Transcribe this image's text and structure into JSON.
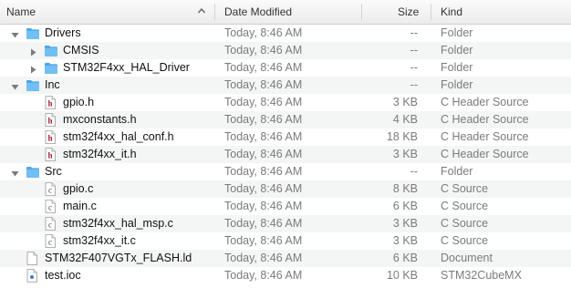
{
  "columns": {
    "name": "Name",
    "date": "Date Modified",
    "size": "Size",
    "kind": "Kind"
  },
  "rows": [
    {
      "name": "Drivers",
      "date": "Today, 8:46 AM",
      "size": "--",
      "kind": "Folder",
      "icon": "folder-icon",
      "level": 0,
      "disclosure": "expanded",
      "alt": false
    },
    {
      "name": "CMSIS",
      "date": "Today, 8:46 AM",
      "size": "--",
      "kind": "Folder",
      "icon": "folder-icon",
      "level": 1,
      "disclosure": "collapsed",
      "alt": true
    },
    {
      "name": "STM32F4xx_HAL_Driver",
      "date": "Today, 8:46 AM",
      "size": "--",
      "kind": "Folder",
      "icon": "folder-icon",
      "level": 1,
      "disclosure": "collapsed",
      "alt": false
    },
    {
      "name": "Inc",
      "date": "Today, 8:46 AM",
      "size": "--",
      "kind": "Folder",
      "icon": "folder-icon",
      "level": 0,
      "disclosure": "expanded",
      "alt": true
    },
    {
      "name": "gpio.h",
      "date": "Today, 8:46 AM",
      "size": "3 KB",
      "kind": "C Header Source",
      "icon": "c-header-file-icon",
      "level": 1,
      "disclosure": "none",
      "alt": false
    },
    {
      "name": "mxconstants.h",
      "date": "Today, 8:46 AM",
      "size": "4 KB",
      "kind": "C Header Source",
      "icon": "c-header-file-icon",
      "level": 1,
      "disclosure": "none",
      "alt": true
    },
    {
      "name": "stm32f4xx_hal_conf.h",
      "date": "Today, 8:46 AM",
      "size": "18 KB",
      "kind": "C Header Source",
      "icon": "c-header-file-icon",
      "level": 1,
      "disclosure": "none",
      "alt": false
    },
    {
      "name": "stm32f4xx_it.h",
      "date": "Today, 8:46 AM",
      "size": "3 KB",
      "kind": "C Header Source",
      "icon": "c-header-file-icon",
      "level": 1,
      "disclosure": "none",
      "alt": true
    },
    {
      "name": "Src",
      "date": "Today, 8:46 AM",
      "size": "--",
      "kind": "Folder",
      "icon": "folder-icon",
      "level": 0,
      "disclosure": "expanded",
      "alt": false
    },
    {
      "name": "gpio.c",
      "date": "Today, 8:46 AM",
      "size": "8 KB",
      "kind": "C Source",
      "icon": "c-source-file-icon",
      "level": 1,
      "disclosure": "none",
      "alt": true
    },
    {
      "name": "main.c",
      "date": "Today, 8:46 AM",
      "size": "6 KB",
      "kind": "C Source",
      "icon": "c-source-file-icon",
      "level": 1,
      "disclosure": "none",
      "alt": false
    },
    {
      "name": "stm32f4xx_hal_msp.c",
      "date": "Today, 8:46 AM",
      "size": "3 KB",
      "kind": "C Source",
      "icon": "c-source-file-icon",
      "level": 1,
      "disclosure": "none",
      "alt": true
    },
    {
      "name": "stm32f4xx_it.c",
      "date": "Today, 8:46 AM",
      "size": "3 KB",
      "kind": "C Source",
      "icon": "c-source-file-icon",
      "level": 1,
      "disclosure": "none",
      "alt": false
    },
    {
      "name": "STM32F407VGTx_FLASH.ld",
      "date": "Today, 8:46 AM",
      "size": "6 KB",
      "kind": "Document",
      "icon": "document-file-icon",
      "level": 0,
      "disclosure": "none",
      "alt": true
    },
    {
      "name": "test.ioc",
      "date": "Today, 8:46 AM",
      "size": "10 KB",
      "kind": "STM32CubeMX",
      "icon": "ioc-file-icon",
      "level": 0,
      "disclosure": "none",
      "alt": false
    }
  ],
  "colors": {
    "folder": "#5fb4ef",
    "alt_row": "#f4f5f5",
    "secondary_text": "#7b7b7b",
    "c_header_mark": "#9b1b2e",
    "c_source_mark": "#4a4a4a"
  }
}
